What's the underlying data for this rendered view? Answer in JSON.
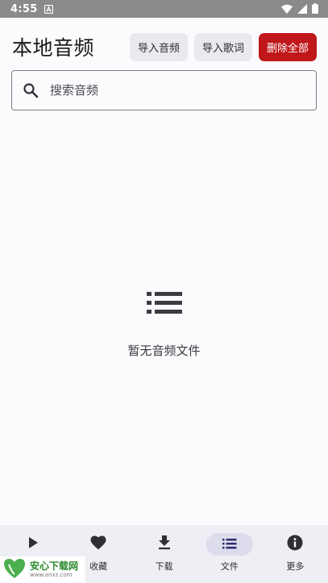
{
  "status_bar": {
    "time": "4:55",
    "icons": [
      "notification-a-icon",
      "wifi-icon",
      "signal-icon",
      "battery-icon"
    ]
  },
  "header": {
    "title": "本地音频",
    "buttons": {
      "import_audio": "导入音频",
      "import_lyrics": "导入歌词",
      "delete_all": "删除全部"
    }
  },
  "search": {
    "placeholder": "搜索音频",
    "value": ""
  },
  "empty_state": {
    "icon": "list-icon",
    "message": "暂无音频文件"
  },
  "bottom_nav": {
    "items": [
      {
        "id": "play",
        "label": "",
        "icon": "play-icon"
      },
      {
        "id": "favorites",
        "label": "收藏",
        "icon": "heart-icon"
      },
      {
        "id": "download",
        "label": "下载",
        "icon": "download-icon"
      },
      {
        "id": "files",
        "label": "文件",
        "icon": "list-icon",
        "active": true
      },
      {
        "id": "more",
        "label": "更多",
        "icon": "info-icon"
      }
    ]
  },
  "watermark": {
    "brand": "安心下载网",
    "url": "www.anxz.com"
  },
  "colors": {
    "accent_danger": "#c0171b",
    "tonal_button": "#e9e9ee",
    "nav_background": "#eeeef5",
    "nav_active_pill": "#dcdcec",
    "status_bar": "#8a8a8a"
  }
}
